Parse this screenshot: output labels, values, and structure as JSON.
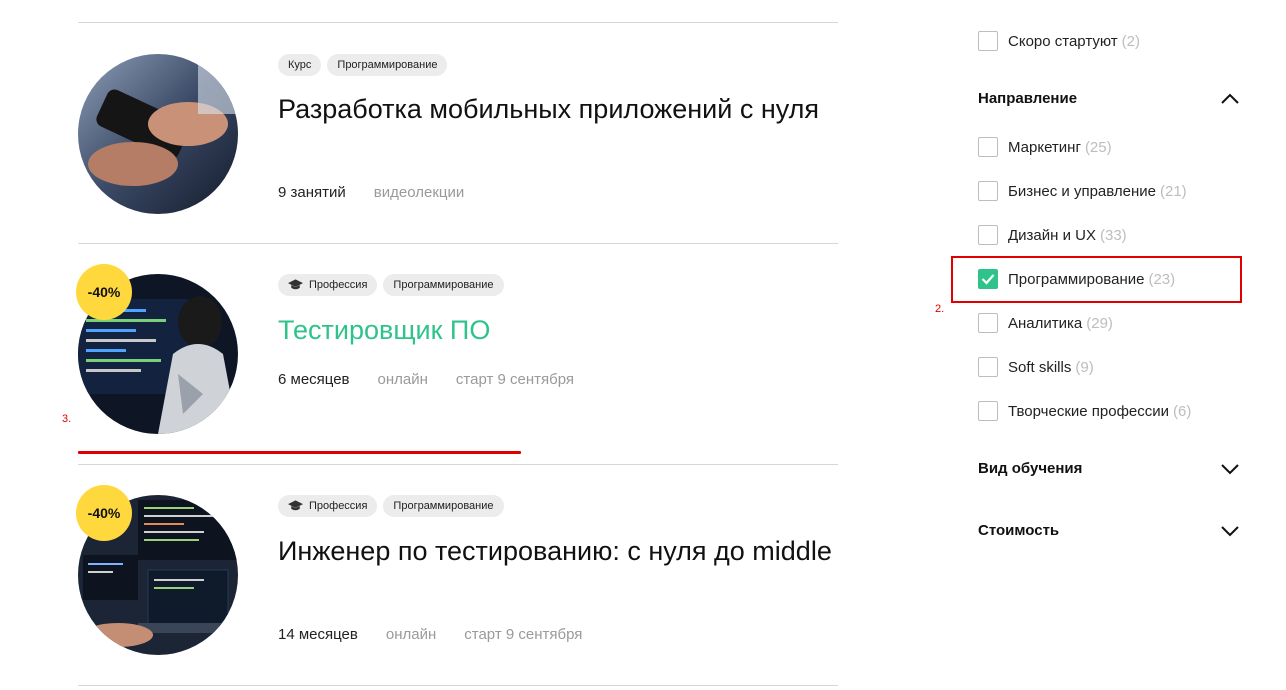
{
  "courses": [
    {
      "tags": [
        "Курс",
        "Программирование"
      ],
      "title": "Разработка мобильных приложений с нуля",
      "meta": [
        "9 занятий",
        "видеолекции"
      ],
      "discount": null
    },
    {
      "tags": [
        "Профессия",
        "Программирование"
      ],
      "title": "Тестировщик ПО",
      "meta": [
        "6 месяцев",
        "онлайн",
        "старт 9 сентября"
      ],
      "discount": "-40%"
    },
    {
      "tags": [
        "Профессия",
        "Программирование"
      ],
      "title": "Инженер по тестированию: с нуля до middle",
      "meta": [
        "14 месяцев",
        "онлайн",
        "старт 9 сентября"
      ],
      "discount": "-40%"
    }
  ],
  "filters": {
    "soon": {
      "label": "Скоро стартуют",
      "count": "(2)",
      "checked": false
    },
    "direction": {
      "title": "Направление",
      "expanded": true,
      "items": [
        {
          "label": "Маркетинг",
          "count": "(25)",
          "checked": false
        },
        {
          "label": "Бизнес и управление",
          "count": "(21)",
          "checked": false
        },
        {
          "label": "Дизайн и UX",
          "count": "(33)",
          "checked": false
        },
        {
          "label": "Программирование",
          "count": "(23)",
          "checked": true
        },
        {
          "label": "Аналитика",
          "count": "(29)",
          "checked": false
        },
        {
          "label": "Soft skills",
          "count": "(9)",
          "checked": false
        },
        {
          "label": "Творческие профессии",
          "count": "(6)",
          "checked": false
        }
      ]
    },
    "learning_type": {
      "title": "Вид обучения",
      "expanded": false
    },
    "cost": {
      "title": "Стоимость",
      "expanded": false
    }
  },
  "annotations": {
    "a2": "2.",
    "a3": "3."
  },
  "colors": {
    "accent": "#2fc38c",
    "discount": "#ffd83d",
    "annotation": "#e10000"
  }
}
